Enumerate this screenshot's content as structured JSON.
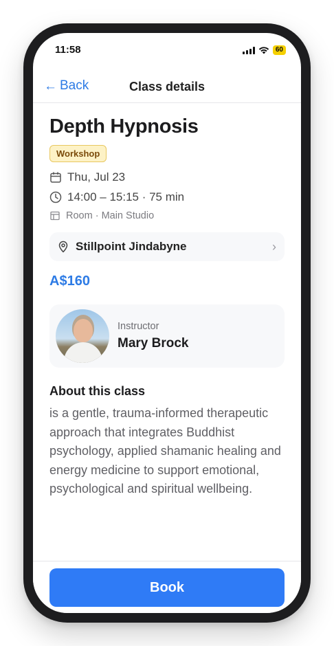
{
  "status_bar": {
    "time": "11:58",
    "battery": "60"
  },
  "nav": {
    "back_label": "Back",
    "title": "Class details"
  },
  "class": {
    "title": "Depth Hypnosis",
    "badge": "Workshop",
    "date": "Thu, Jul 23",
    "time": "14:00 – 15:15 · 75 min",
    "room": "Room · Main Studio",
    "location": "Stillpoint Jindabyne",
    "price": "A$160"
  },
  "instructor": {
    "label": "Instructor",
    "name": "Mary Brock"
  },
  "about": {
    "heading": "About this class",
    "text": "is a gentle, trauma-informed therapeutic approach that integrates Buddhist psychology, applied shamanic healing and energy medicine to support emotional, psychological and spiritual wellbeing."
  },
  "footer": {
    "book_label": "Book"
  },
  "colors": {
    "accent": "#2d7be5",
    "button": "#2f7bf6",
    "badge_bg": "#fdf2c6",
    "badge_text": "#7a4a09"
  },
  "icons": [
    "back-arrow-icon",
    "calendar-icon",
    "clock-icon",
    "room-icon",
    "location-pin-icon",
    "chevron-right-icon",
    "signal-icon",
    "wifi-icon",
    "battery-icon"
  ]
}
